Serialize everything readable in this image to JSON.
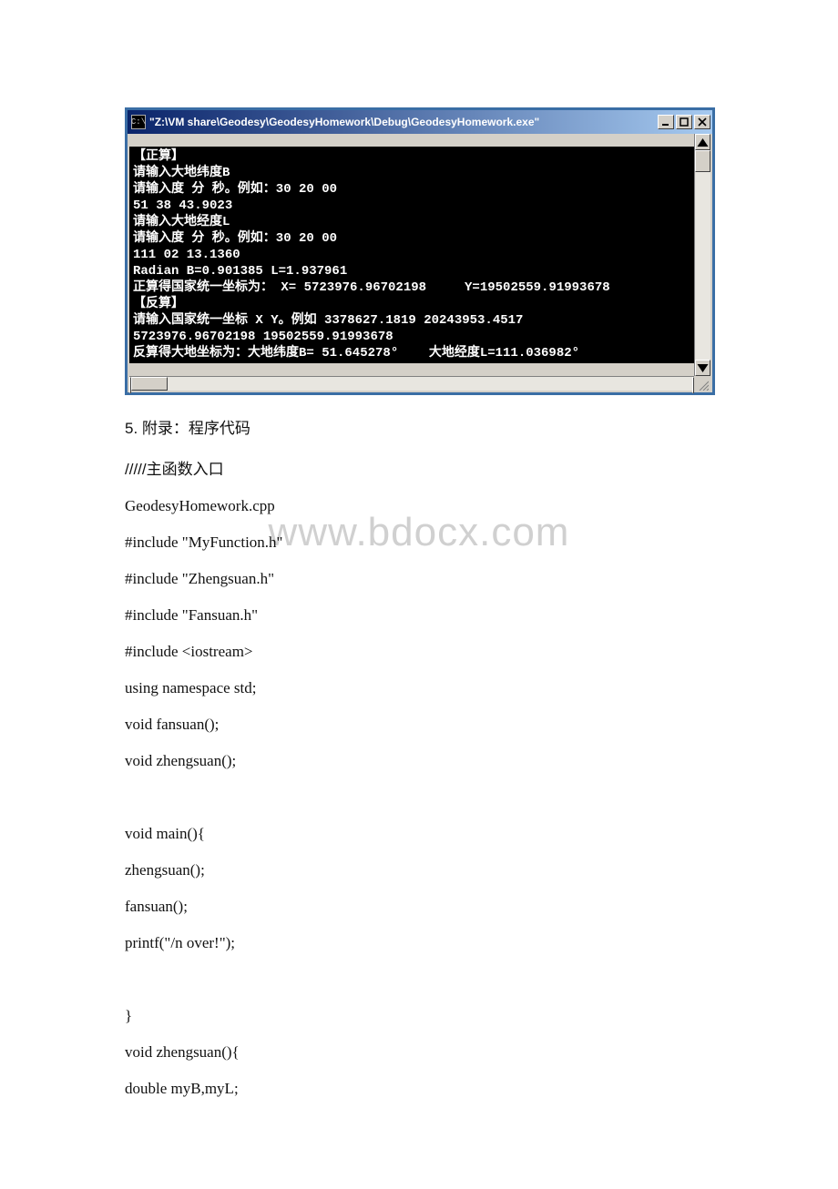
{
  "console_window": {
    "title_icon_text": "C:\\",
    "title": "\"Z:\\VM share\\Geodesy\\GeodesyHomework\\Debug\\GeodesyHomework.exe\"",
    "output_lines": [
      "【正算】",
      "请输入大地纬度B",
      "请输入度 分 秒。例如：30 20 00",
      "51 38 43.9023",
      "请输入大地经度L",
      "请输入度 分 秒。例如：30 20 00",
      "111 02 13.1360",
      "Radian B=0.901385 L=1.937961",
      "正算得国家统一坐标为： X= 5723976.96702198     Y=19502559.91993678",
      "【反算】",
      "请输入国家统一坐标 X Y。例如 3378627.1819 20243953.4517",
      "5723976.96702198 19502559.91993678",
      "反算得大地坐标为：大地纬度B= 51.645278°    大地经度L=111.036982°"
    ]
  },
  "doc": {
    "section_title": "5. 附录：程序代码",
    "comment_main": "/////主函数入口",
    "filename": "GeodesyHomework.cpp",
    "lines": [
      "#include \"MyFunction.h\"",
      "#include \"Zhengsuan.h\"",
      "#include \"Fansuan.h\"",
      "#include <iostream>",
      "using namespace std;",
      "void fansuan();",
      "void zhengsuan();",
      "",
      "void main(){",
      " zhengsuan();",
      " fansuan();",
      " printf(\"/n over!\");",
      "",
      "}",
      "void zhengsuan(){",
      " double myB,myL;"
    ]
  },
  "watermark": "www.bdocx.com"
}
